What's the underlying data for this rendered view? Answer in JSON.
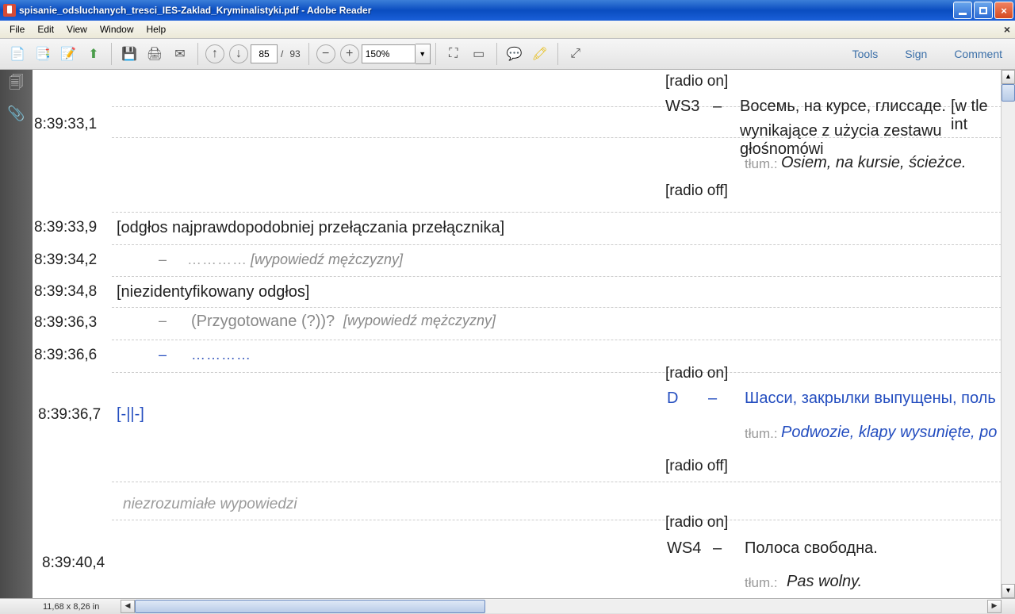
{
  "window": {
    "title": "spisanie_odsluchanych_tresci_IES-Zaklad_Kryminalistyki.pdf - Adobe Reader"
  },
  "menu": {
    "file": "File",
    "edit": "Edit",
    "view": "View",
    "window": "Window",
    "help": "Help"
  },
  "toolbar": {
    "page_current": "85",
    "page_sep": "/",
    "page_total": "93",
    "zoom": "150%",
    "tools": "Tools",
    "sign": "Sign",
    "comment": "Comment"
  },
  "doc": {
    "t0": "8:39:33,1",
    "t1": "8:39:33,9",
    "t1_text": "[odgłos najprawdopodobniej przełączania przełącznika]",
    "t2": "8:39:34,2",
    "t2_dash": "–",
    "t2_dots": "…………",
    "t2_note": "[wypowiedź mężczyzny]",
    "t3": "8:39:34,8",
    "t3_text": "[niezidentyfikowany odgłos]",
    "t4": "8:39:36,3",
    "t4_dash": "–",
    "t4_main": "(Przygotowane (?))?",
    "t4_note": "[wypowiedź mężczyzny]",
    "t5": "8:39:36,6",
    "t5_dash": "–",
    "t5_dots": "…………",
    "t6": "8:39:36,7",
    "t6_text": "[-||-]",
    "t7": "niezrozumiałe wypowiedzi",
    "t8": "8:39:40,4",
    "r_radio_on1": "[radio on]",
    "r_ws3": "WS3",
    "r_dash": "–",
    "r_ws3_text": "Восемь, на курсе, глиссаде.",
    "r_ws3_note": "[w tle int",
    "r_ws3_line2": "wynikające z użycia zestawu głośnomówi",
    "r_tlum": "tłum.:",
    "r_ws3_trans": "Osiem, na kursie, ścieżce.",
    "r_radio_off1": "[radio off]",
    "r_radio_on2": "[radio on]",
    "r_d": "D",
    "r_d_text": "Шасси, закрылки выпущены, поль",
    "r_d_trans": "Podwozie, klapy wysunięte, po",
    "r_radio_off2": "[radio off]",
    "r_radio_on3": "[radio on]",
    "r_ws4": "WS4",
    "r_ws4_text": "Полоса свободна.",
    "r_ws4_trans": "Pas wolny."
  },
  "status": {
    "dim": "11,68 x 8,26 in"
  }
}
